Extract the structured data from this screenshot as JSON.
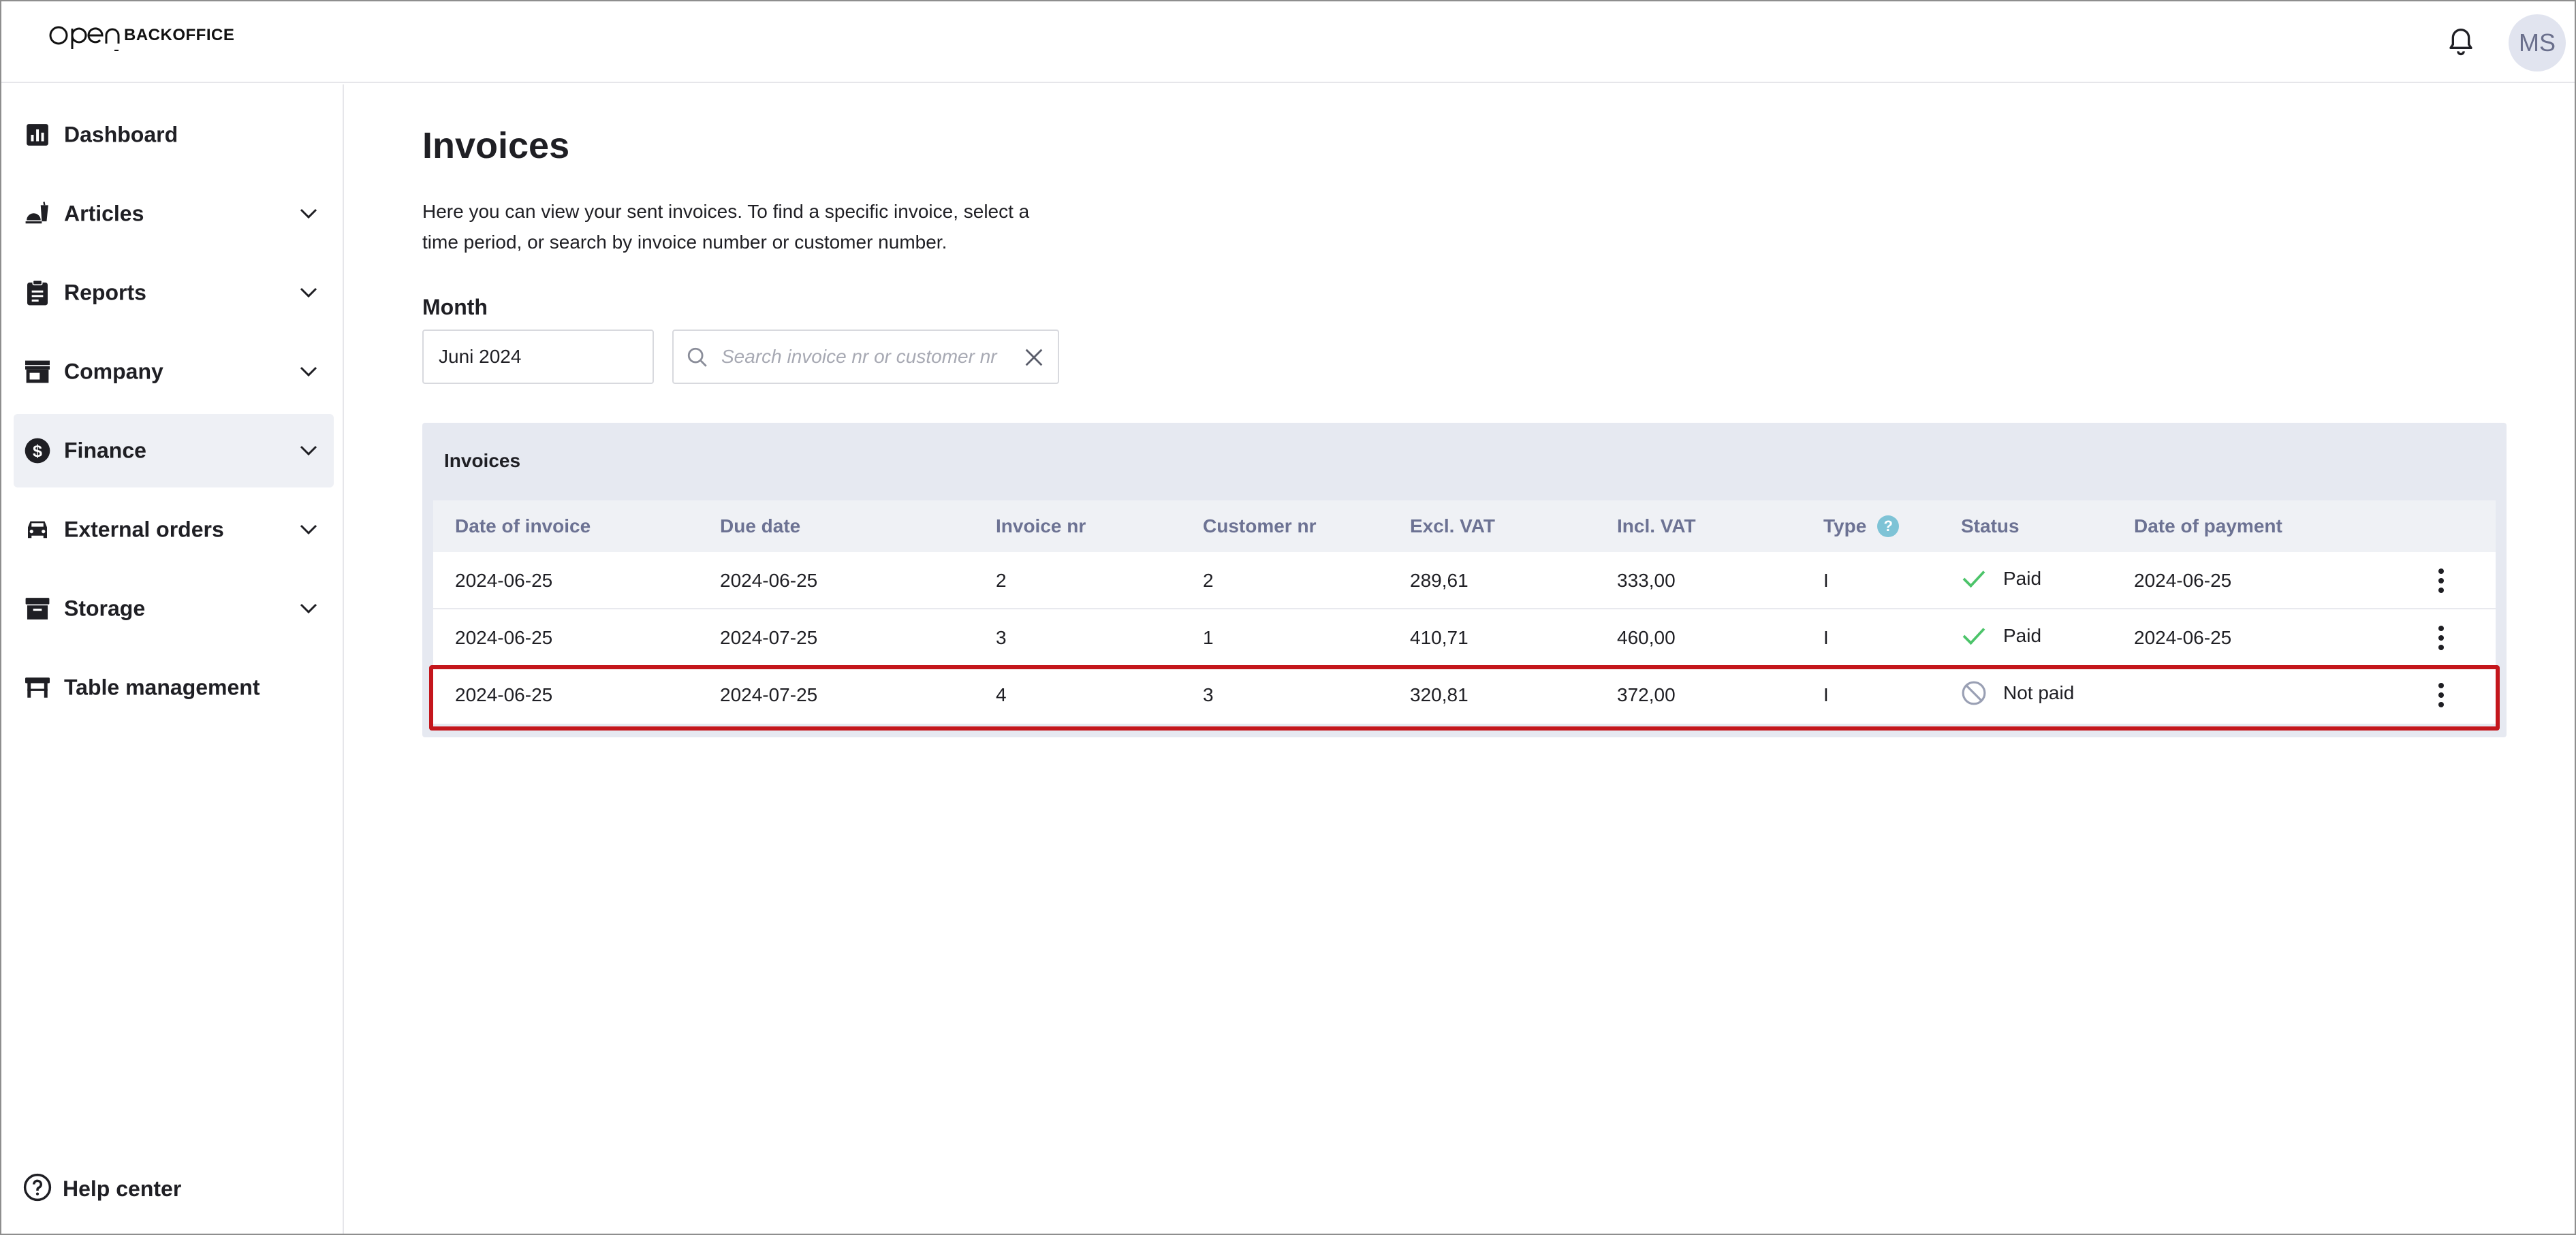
{
  "app": {
    "logo_text": "BACKOFFICE",
    "logo_mark": "open",
    "user_initials": "MS"
  },
  "sidebar": {
    "items": [
      {
        "label": "Dashboard",
        "icon": "chart-icon",
        "expandable": false
      },
      {
        "label": "Articles",
        "icon": "food-icon",
        "expandable": true
      },
      {
        "label": "Reports",
        "icon": "clipboard-icon",
        "expandable": true
      },
      {
        "label": "Company",
        "icon": "store-icon",
        "expandable": true
      },
      {
        "label": "Finance",
        "icon": "dollar-icon",
        "expandable": true,
        "active": true
      },
      {
        "label": "External orders",
        "icon": "car-icon",
        "expandable": true
      },
      {
        "label": "Storage",
        "icon": "archive-icon",
        "expandable": true
      },
      {
        "label": "Table management",
        "icon": "table-icon",
        "expandable": false
      }
    ],
    "help_label": "Help center"
  },
  "page": {
    "title": "Invoices",
    "description": "Here you can view your sent invoices. To find a specific invoice, select a time period, or search by invoice number or customer number.",
    "month_label": "Month",
    "month_value": "Juni 2024",
    "search_placeholder": "Search invoice nr or customer nr",
    "search_value": ""
  },
  "table": {
    "title": "Invoices",
    "columns": [
      "Date of invoice",
      "Due date",
      "Invoice nr",
      "Customer nr",
      "Excl. VAT",
      "Incl. VAT",
      "Type",
      "Status",
      "Date of payment"
    ],
    "type_help": "?",
    "rows": [
      {
        "date_of_invoice": "2024-06-25",
        "due_date": "2024-06-25",
        "invoice_nr": "2",
        "customer_nr": "2",
        "excl_vat": "289,61",
        "incl_vat": "333,00",
        "type": "I",
        "status": "Paid",
        "date_of_payment": "2024-06-25"
      },
      {
        "date_of_invoice": "2024-06-25",
        "due_date": "2024-07-25",
        "invoice_nr": "3",
        "customer_nr": "1",
        "excl_vat": "410,71",
        "incl_vat": "460,00",
        "type": "I",
        "status": "Paid",
        "date_of_payment": "2024-06-25"
      },
      {
        "date_of_invoice": "2024-06-25",
        "due_date": "2024-07-25",
        "invoice_nr": "4",
        "customer_nr": "3",
        "excl_vat": "320,81",
        "incl_vat": "372,00",
        "type": "I",
        "status": "Not paid",
        "date_of_payment": ""
      }
    ],
    "highlighted_row": 2
  },
  "colors": {
    "paid": "#4cc46a",
    "not_paid": "#9aa0b4",
    "highlight": "#c4161c",
    "header_text": "#6c7293",
    "panel_bg": "#e6e9f1",
    "active_nav_bg": "#eef0f5"
  }
}
